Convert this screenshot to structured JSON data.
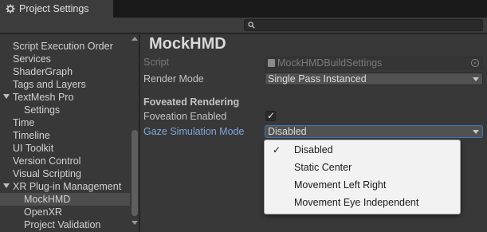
{
  "window": {
    "tab_title": "Project Settings",
    "tab_icon": "gear-icon"
  },
  "search": {
    "icon": "search-icon",
    "value": ""
  },
  "sidebar": {
    "items": [
      {
        "label": "Script Execution Order",
        "indent": 1,
        "selected": false
      },
      {
        "label": "Services",
        "indent": 1,
        "selected": false
      },
      {
        "label": "ShaderGraph",
        "indent": 1,
        "selected": false
      },
      {
        "label": "Tags and Layers",
        "indent": 1,
        "selected": false
      },
      {
        "label": "TextMesh Pro",
        "indent": 1,
        "expanded": true,
        "selected": false
      },
      {
        "label": "Settings",
        "indent": 2,
        "selected": false
      },
      {
        "label": "Time",
        "indent": 1,
        "selected": false
      },
      {
        "label": "Timeline",
        "indent": 1,
        "selected": false
      },
      {
        "label": "UI Toolkit",
        "indent": 1,
        "selected": false
      },
      {
        "label": "Version Control",
        "indent": 1,
        "selected": false
      },
      {
        "label": "Visual Scripting",
        "indent": 1,
        "selected": false
      },
      {
        "label": "XR Plug-in Management",
        "indent": 1,
        "expanded": true,
        "selected": false
      },
      {
        "label": "MockHMD",
        "indent": 2,
        "selected": true
      },
      {
        "label": "OpenXR",
        "indent": 2,
        "selected": false
      },
      {
        "label": "Project Validation",
        "indent": 2,
        "selected": false
      }
    ]
  },
  "main": {
    "title": "MockHMD",
    "script_label": "Script",
    "script_value": "MockHMDBuildSettings",
    "render_mode_label": "Render Mode",
    "render_mode_value": "Single Pass Instanced",
    "foveated_header": "Foveated Rendering",
    "foveation_enabled_label": "Foveation Enabled",
    "foveation_enabled": true,
    "gaze_mode_label": "Gaze Simulation Mode",
    "gaze_mode_value": "Disabled"
  },
  "dropdown": {
    "options": [
      {
        "label": "Disabled",
        "checked": true
      },
      {
        "label": "Static Center",
        "checked": false
      },
      {
        "label": "Movement Left Right",
        "checked": false
      },
      {
        "label": "Movement Eye Independent",
        "checked": false
      }
    ],
    "check_glyph": "✓"
  },
  "colors": {
    "accent": "#3a79bb",
    "highlight_label": "#7fa7dc",
    "panel_bg": "#383838"
  }
}
